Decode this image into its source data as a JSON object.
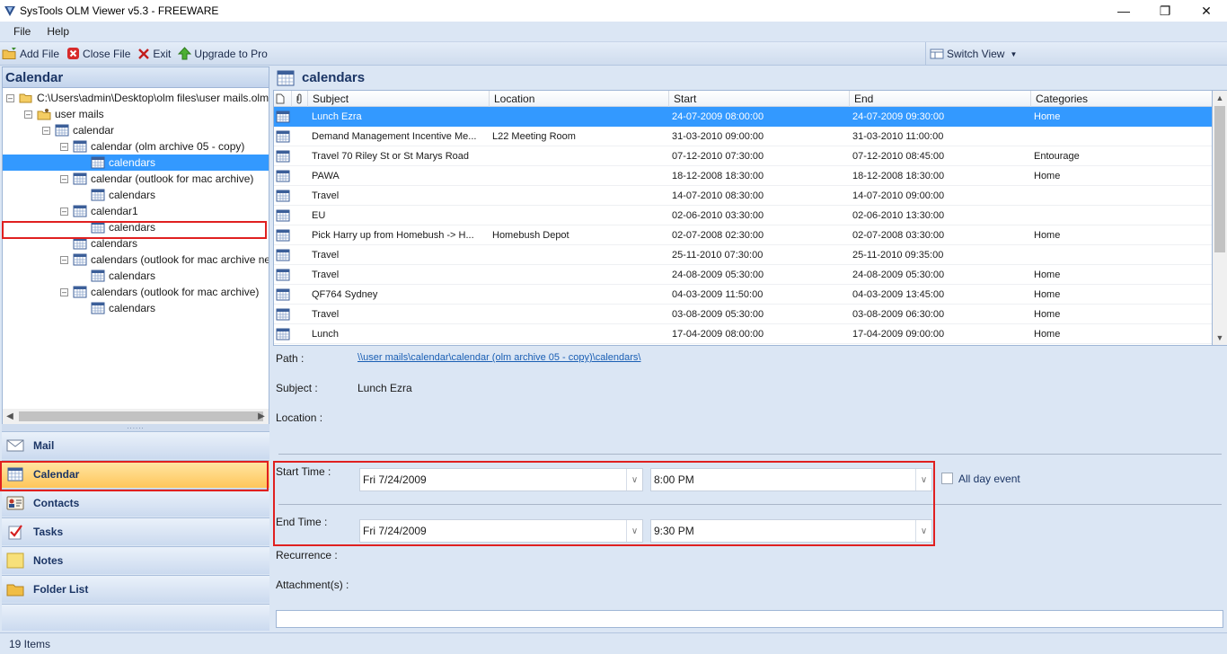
{
  "window": {
    "title": "SysTools OLM Viewer v5.3 - FREEWARE"
  },
  "menu": {
    "items": [
      "File",
      "Help"
    ]
  },
  "toolbar": {
    "add_file": "Add File",
    "close_file": "Close File",
    "exit": "Exit",
    "upgrade": "Upgrade to Pro",
    "switch_view": "Switch View"
  },
  "left_pane": {
    "header": "Calendar",
    "tree": [
      {
        "label": "C:\\Users\\admin\\Desktop\\olm files\\user mails.olm",
        "icon": "folder-open-icon"
      },
      {
        "label": "user mails",
        "icon": "folder-user-icon"
      },
      {
        "label": "calendar",
        "icon": "calendar-icon"
      },
      {
        "label": "calendar (olm archive 05 - copy)",
        "icon": "calendar-icon"
      },
      {
        "label": "calendars",
        "icon": "calendar-icon",
        "selected": true
      },
      {
        "label": "calendar (outlook for mac archive)",
        "icon": "calendar-icon"
      },
      {
        "label": "calendars",
        "icon": "calendar-icon"
      },
      {
        "label": "calendar1",
        "icon": "calendar-icon"
      },
      {
        "label": "calendars",
        "icon": "calendar-icon"
      },
      {
        "label": "calendars",
        "icon": "calendar-icon"
      },
      {
        "label": "calendars (outlook for mac archive new)",
        "icon": "calendar-icon"
      },
      {
        "label": "calendars",
        "icon": "calendar-icon"
      },
      {
        "label": "calendars (outlook for mac archive)",
        "icon": "calendar-icon"
      },
      {
        "label": "calendars",
        "icon": "calendar-icon"
      }
    ],
    "nav": [
      {
        "label": "Mail",
        "icon": "mail-icon"
      },
      {
        "label": "Calendar",
        "icon": "calendar-icon",
        "active": true
      },
      {
        "label": "Contacts",
        "icon": "contacts-icon"
      },
      {
        "label": "Tasks",
        "icon": "tasks-icon"
      },
      {
        "label": "Notes",
        "icon": "notes-icon"
      },
      {
        "label": "Folder List",
        "icon": "folder-icon"
      }
    ]
  },
  "right_pane": {
    "header": "calendars",
    "columns": [
      "Subject",
      "Location",
      "Start",
      "End",
      "Categories"
    ],
    "rows": [
      {
        "subject": "Lunch Ezra",
        "location": "",
        "start": "24-07-2009 08:00:00",
        "end": "24-07-2009 09:30:00",
        "category": "Home",
        "selected": true
      },
      {
        "subject": "Demand Management Incentive Me...",
        "location": "L22 Meeting Room",
        "start": "31-03-2010 09:00:00",
        "end": "31-03-2010 11:00:00",
        "category": ""
      },
      {
        "subject": "Travel 70 Riley St or St Marys Road",
        "location": "",
        "start": "07-12-2010 07:30:00",
        "end": "07-12-2010 08:45:00",
        "category": "Entourage"
      },
      {
        "subject": "PAWA",
        "location": "",
        "start": "18-12-2008 18:30:00",
        "end": "18-12-2008 18:30:00",
        "category": "Home"
      },
      {
        "subject": "Travel",
        "location": "",
        "start": "14-07-2010 08:30:00",
        "end": "14-07-2010 09:00:00",
        "category": ""
      },
      {
        "subject": "EU",
        "location": "",
        "start": "02-06-2010 03:30:00",
        "end": "02-06-2010 13:30:00",
        "category": ""
      },
      {
        "subject": "Pick Harry up from Homebush -> H...",
        "location": "Homebush Depot",
        "start": "02-07-2008 02:30:00",
        "end": "02-07-2008 03:30:00",
        "category": "Home"
      },
      {
        "subject": "Travel",
        "location": "",
        "start": "25-11-2010 07:30:00",
        "end": "25-11-2010 09:35:00",
        "category": ""
      },
      {
        "subject": "Travel",
        "location": "",
        "start": "24-08-2009 05:30:00",
        "end": "24-08-2009 05:30:00",
        "category": "Home"
      },
      {
        "subject": "QF764 Sydney",
        "location": "",
        "start": "04-03-2009 11:50:00",
        "end": "04-03-2009 13:45:00",
        "category": "Home"
      },
      {
        "subject": "Travel",
        "location": "",
        "start": "03-08-2009 05:30:00",
        "end": "03-08-2009 06:30:00",
        "category": "Home"
      },
      {
        "subject": "Lunch",
        "location": "",
        "start": "17-04-2009 08:00:00",
        "end": "17-04-2009 09:00:00",
        "category": "Home"
      }
    ]
  },
  "detail": {
    "path_label": "Path :",
    "path_value": "\\\\user mails\\calendar\\calendar (olm archive 05 - copy)\\calendars\\",
    "subject_label": "Subject :",
    "subject_value": "Lunch Ezra",
    "location_label": "Location :",
    "start_label": "Start Time :",
    "start_date": "Fri 7/24/2009",
    "start_time": "8:00 PM",
    "all_day_label": "All day event",
    "end_label": "End Time :",
    "end_date": "Fri 7/24/2009",
    "end_time": "9:30 PM",
    "recurrence_label": "Recurrence :",
    "attachments_label": "Attachment(s) :"
  },
  "status": {
    "items_count": "19 Items"
  },
  "colors": {
    "selection": "#3399ff",
    "highlight_border": "#e02020",
    "active_nav": "#ffc65a"
  }
}
